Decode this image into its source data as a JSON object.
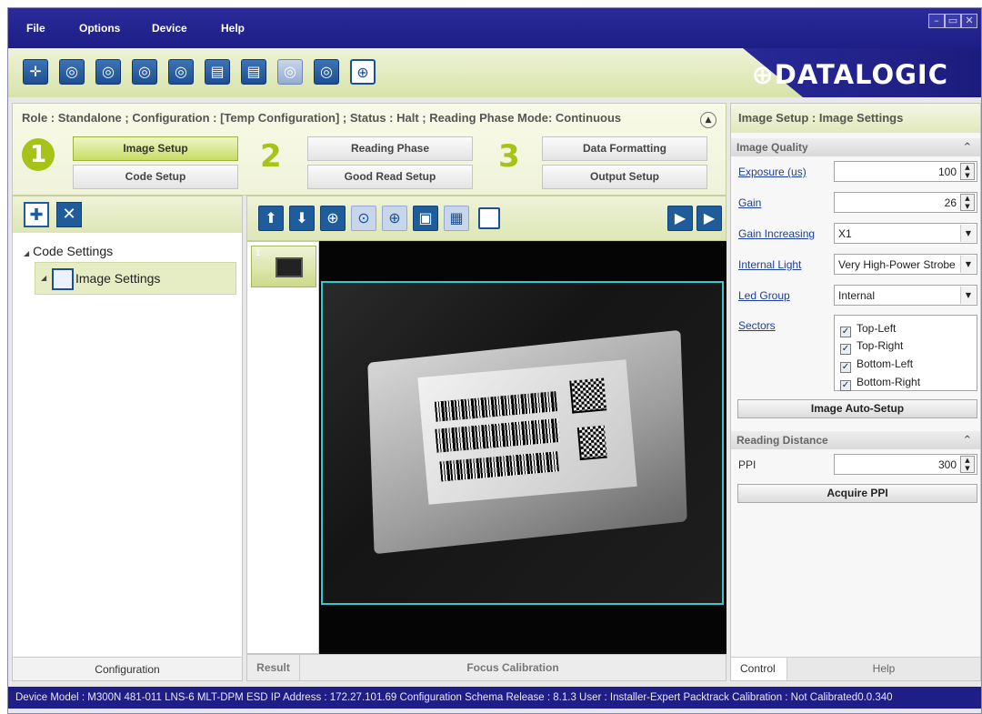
{
  "menu": [
    "File",
    "Options",
    "Device",
    "Help"
  ],
  "window_controls": [
    "–",
    "▭",
    "✕"
  ],
  "brand": "DATALOGIC",
  "toolbar_icons": [
    "connect-icon",
    "camera-icon",
    "camera-add-icon",
    "camera-out-icon",
    "camera-save-icon",
    "export-icon",
    "save-icon",
    "camera-light-icon",
    "camera-list-icon",
    "crosshair-icon"
  ],
  "role_line": "Role : Standalone ; Configuration : [Temp Configuration] ; Status : Halt ; Reading Phase Mode: Continuous",
  "steps": {
    "one": "1",
    "two": "2",
    "three": "3",
    "image_setup": "Image Setup",
    "code_setup": "Code Setup",
    "reading_phase": "Reading Phase",
    "good_read_setup": "Good Read Setup",
    "data_formatting": "Data Formatting",
    "output_setup": "Output Setup"
  },
  "tree": {
    "root": "Code Settings",
    "child": "Image Settings"
  },
  "left_tab": "Configuration",
  "thumb_number": "1",
  "center_tabs": {
    "result": "Result",
    "focus": "Focus Calibration"
  },
  "right": {
    "header": "Image Setup : Image Settings",
    "image_quality": "Image Quality",
    "exposure_label": "Exposure (us)",
    "exposure_value": "100",
    "gain_label": "Gain",
    "gain_value": "26",
    "gain_inc_label": "Gain Increasing",
    "gain_inc_value": "X1",
    "internal_light_label": "Internal Light",
    "internal_light_value": "Very High-Power Strobed",
    "led_group_label": "Led Group",
    "led_group_value": "Internal",
    "sectors_label": "Sectors",
    "sectors": [
      "Top-Left",
      "Top-Right",
      "Bottom-Left",
      "Bottom-Right"
    ],
    "auto_setup": "Image Auto-Setup",
    "reading_distance": "Reading Distance",
    "ppi_label": "PPI",
    "ppi_value": "300",
    "acquire_ppi": "Acquire PPI",
    "tab_control": "Control",
    "tab_help": "Help"
  },
  "status_bar": "Device Model : M300N  481-011  LNS-6 MLT-DPM ESD   IP Address :  172.27.101.69   Configuration Schema Release :  8.1.3   User : Installer-Expert   Packtrack Calibration : Not Calibrated0.0.340"
}
